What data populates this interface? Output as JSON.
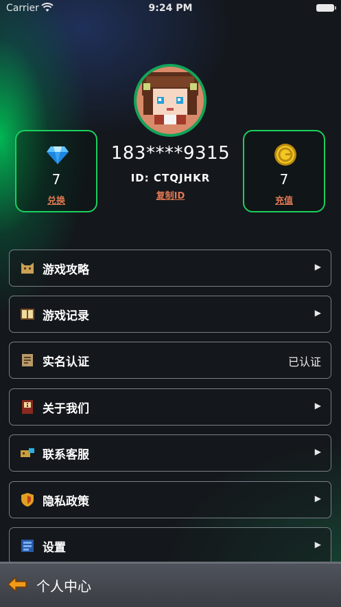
{
  "status_bar": {
    "carrier": "Carrier",
    "time": "9:24 PM"
  },
  "profile": {
    "username": "183****9315",
    "id_text": "ID: CTQJHKR",
    "copy_id_label": "复制ID"
  },
  "gems": {
    "value": "7",
    "action_label": "兑换",
    "icon": "blue-diamond-icon"
  },
  "coins": {
    "value": "7",
    "action_label": "充值",
    "icon": "gold-coin-icon"
  },
  "menu": [
    {
      "label": "游戏攻略",
      "icon": "cat-icon",
      "trailing": "▶"
    },
    {
      "label": "游戏记录",
      "icon": "book-icon",
      "trailing": "▶"
    },
    {
      "label": "实名认证",
      "icon": "scroll-icon",
      "trailing": "已认证"
    },
    {
      "label": "关于我们",
      "icon": "info-book-icon",
      "trailing": "▶"
    },
    {
      "label": "联系客服",
      "icon": "support-icon",
      "trailing": "▶"
    },
    {
      "label": "隐私政策",
      "icon": "shield-icon",
      "trailing": "▶"
    },
    {
      "label": "设置",
      "icon": "settings-icon",
      "trailing": "▶"
    }
  ],
  "bottom_bar": {
    "title": "个人中心",
    "back_icon": "back-arrow-icon"
  },
  "colors": {
    "accent_green": "#1ad15e",
    "link_orange": "#e07852",
    "background": "#14171c"
  }
}
